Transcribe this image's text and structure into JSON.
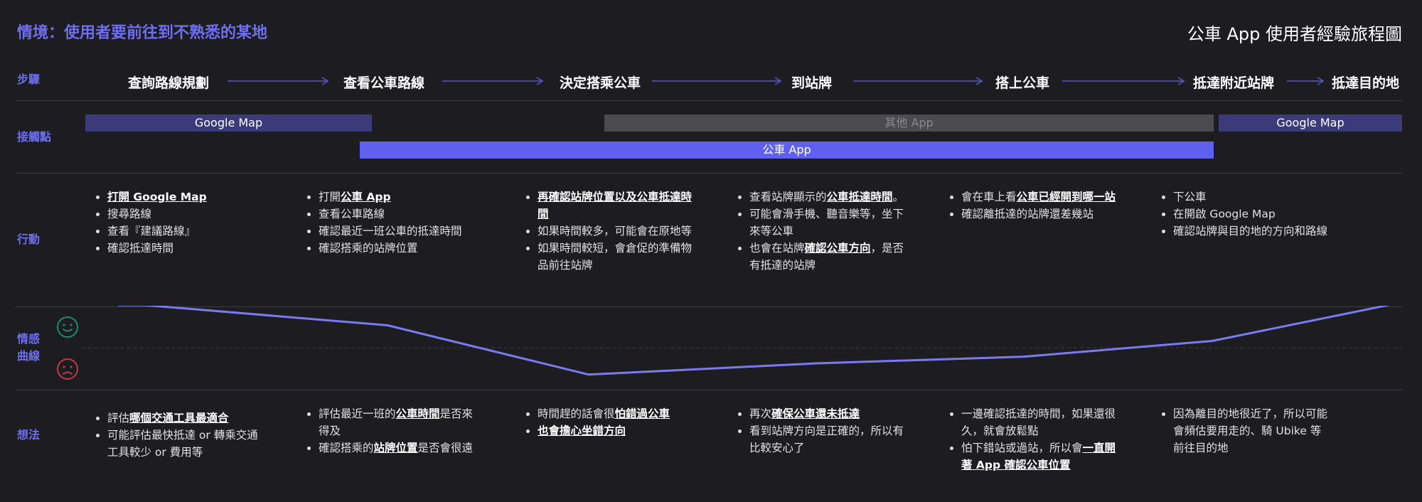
{
  "scenario": "情境：使用者要前往到不熟悉的某地",
  "map_title": "公車 App 使用者經驗旅程圖",
  "row_labels": {
    "steps": "步驟",
    "touchpoints": "接觸點",
    "actions": "行動",
    "emotion_1": "情感",
    "emotion_2": "曲線",
    "thoughts": "想法"
  },
  "steps": [
    "查詢路線規劃",
    "查看公車路線",
    "決定搭乘公車",
    "到站牌",
    "搭上公車",
    "抵達附近站牌",
    "抵達目的地"
  ],
  "touchpoints": {
    "google_map_1": "Google Map",
    "other_app": "其他 App",
    "google_map_2": "Google Map",
    "bus_app": "公車 App"
  },
  "actions": [
    [
      [
        {
          "t": "打開 Google Map",
          "b": true
        }
      ],
      [
        {
          "t": "搜尋路線"
        }
      ],
      [
        {
          "t": "查看『建議路線』"
        }
      ],
      [
        {
          "t": "確認抵達時間"
        }
      ]
    ],
    [
      [
        {
          "t": "打開"
        },
        {
          "t": "公車 App",
          "b": true
        }
      ],
      [
        {
          "t": "查看公車路線"
        }
      ],
      [
        {
          "t": "確認最近一班公車的抵達時間"
        }
      ],
      [
        {
          "t": "確認搭乘的站牌位置"
        }
      ]
    ],
    [
      [
        {
          "t": "再確認站牌位置以及公車抵達時間",
          "b": true
        }
      ],
      [
        {
          "t": "如果時間較多，可能會在原地等"
        }
      ],
      [
        {
          "t": "如果時間較短，會倉促的準備物品前往站牌"
        }
      ]
    ],
    [
      [
        {
          "t": "查看站牌顯示的"
        },
        {
          "t": "公車抵達時間",
          "b": true
        },
        {
          "t": "。"
        }
      ],
      [
        {
          "t": "可能會滑手機、聽音樂等，坐下來等公車"
        }
      ],
      [
        {
          "t": "也會在站牌"
        },
        {
          "t": "確認公車方向",
          "b": true
        },
        {
          "t": "，是否有抵達的站牌"
        }
      ]
    ],
    [
      [
        {
          "t": "會在車上看"
        },
        {
          "t": "公車已經開到哪一站",
          "b": true
        }
      ],
      [
        {
          "t": "確認離抵達的站牌還差幾站"
        }
      ]
    ],
    [
      [
        {
          "t": "下公車"
        }
      ],
      [
        {
          "t": "在開啟 Google Map"
        }
      ],
      [
        {
          "t": "確認站牌與目的地的方向和路線"
        }
      ]
    ]
  ],
  "thoughts": [
    [
      [
        {
          "t": "評估"
        },
        {
          "t": "哪個交通工具最適合",
          "b": true
        }
      ],
      [
        {
          "t": "可能評估最快抵達 or 轉乘交通工具較少 or 費用等"
        }
      ]
    ],
    [
      [
        {
          "t": "評估最近一班的"
        },
        {
          "t": "公車時間",
          "b": true
        },
        {
          "t": "是否來得及"
        }
      ],
      [
        {
          "t": "確認搭乘的"
        },
        {
          "t": "站牌位置",
          "b": true
        },
        {
          "t": "是否會很遠"
        }
      ]
    ],
    [
      [
        {
          "t": "時間趕的話會很"
        },
        {
          "t": "怕錯過公車",
          "b": true
        }
      ],
      [
        {
          "t": "也會擔心坐錯方向",
          "b": true
        }
      ]
    ],
    [
      [
        {
          "t": "再次"
        },
        {
          "t": "確保公車還未抵達",
          "b": true
        }
      ],
      [
        {
          "t": "看到站牌方向是正確的，所以有比較安心了"
        }
      ]
    ],
    [
      [
        {
          "t": "一邊確認抵達的時間，如果還很久，就會放鬆點"
        }
      ],
      [
        {
          "t": "怕下錯站或過站，所以會"
        },
        {
          "t": "一直開著 App 確認公車位置",
          "b": true
        }
      ]
    ],
    [
      [
        {
          "t": "因為離目的地很近了，所以可能會頻估要用走的、騎 Ubike 等前往目的地"
        }
      ]
    ]
  ],
  "emotion_curve": {
    "scale": "-1 (unhappy) to 1 (happy)",
    "values": [
      0.95,
      0.95,
      0.5,
      -0.6,
      -0.35,
      -0.2,
      0.15,
      0.95
    ]
  },
  "icons": {
    "happy": "happy-face-icon",
    "sad": "sad-face-icon"
  },
  "colors": {
    "accent": "#6e6ef0",
    "happy": "#1f8a6e",
    "sad": "#c0394a",
    "curve": "#7b7bf0"
  }
}
